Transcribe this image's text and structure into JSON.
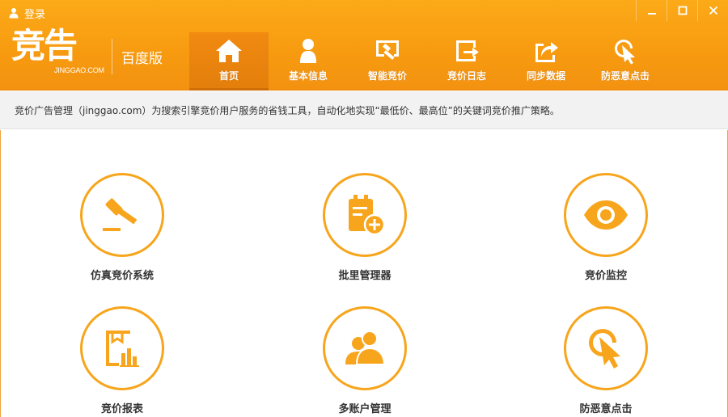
{
  "header": {
    "login_label": "登录",
    "logo_text": "竞告",
    "logo_sub": "JINGGAO.COM",
    "edition": "百度版",
    "accent_color": "#f79a10",
    "icon_color": "#f7a51c"
  },
  "window_controls": {
    "minimize_icon": "minimize-icon",
    "maximize_icon": "maximize-icon",
    "close_icon": "close-icon"
  },
  "nav": {
    "items": [
      {
        "label": "首页",
        "icon": "home-icon",
        "active": true
      },
      {
        "label": "基本信息",
        "icon": "user-icon",
        "active": false
      },
      {
        "label": "智能竞价",
        "icon": "auction-icon",
        "active": false
      },
      {
        "label": "竞价日志",
        "icon": "log-icon",
        "active": false
      },
      {
        "label": "同步数据",
        "icon": "sync-icon",
        "active": false
      },
      {
        "label": "防恶意点击",
        "icon": "cursor-click-icon",
        "active": false
      }
    ]
  },
  "description": "竞价广告管理（jinggao.com）为搜索引擎竞价用户服务的省钱工具，自动化地实现“最低价、最高位”的关键词竞价推广策略。",
  "features": [
    {
      "label": "仿真竞价系统",
      "icon": "gavel-icon"
    },
    {
      "label": "批里管理器",
      "icon": "clipboard-add-icon"
    },
    {
      "label": "竞价监控",
      "icon": "eye-icon"
    },
    {
      "label": "竞价报表",
      "icon": "report-icon"
    },
    {
      "label": "多账户管理",
      "icon": "users-icon"
    },
    {
      "label": "防恶意点击",
      "icon": "cursor-click-icon"
    }
  ]
}
